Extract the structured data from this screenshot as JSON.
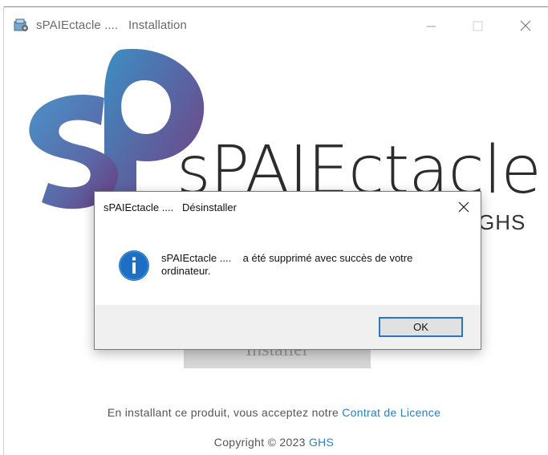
{
  "main_window": {
    "title": "sPAIEctacle ....   Installation",
    "icon": "installer-package-icon",
    "brand_name": "sPAIEctacle",
    "brand_sub": "GHS",
    "install_label": "Installer",
    "footer_text": "En installant ce produit, vous acceptez notre ",
    "footer_link": "Contrat de Licence",
    "copyright_text": "Copyright © 2023 ",
    "copyright_link": "GHS"
  },
  "dialog": {
    "title": "sPAIEctacle ....   Désinstaller",
    "message": "sPAIEctacle ....    a été supprimé avec succès de votre\nordinateur.",
    "ok_label": "OK",
    "icon": "info-icon"
  },
  "colors": {
    "link": "#2b7fc4",
    "accent": "#2b75c8",
    "logo_blue": "#3c8fc4",
    "logo_purple": "#6b3a7c"
  }
}
